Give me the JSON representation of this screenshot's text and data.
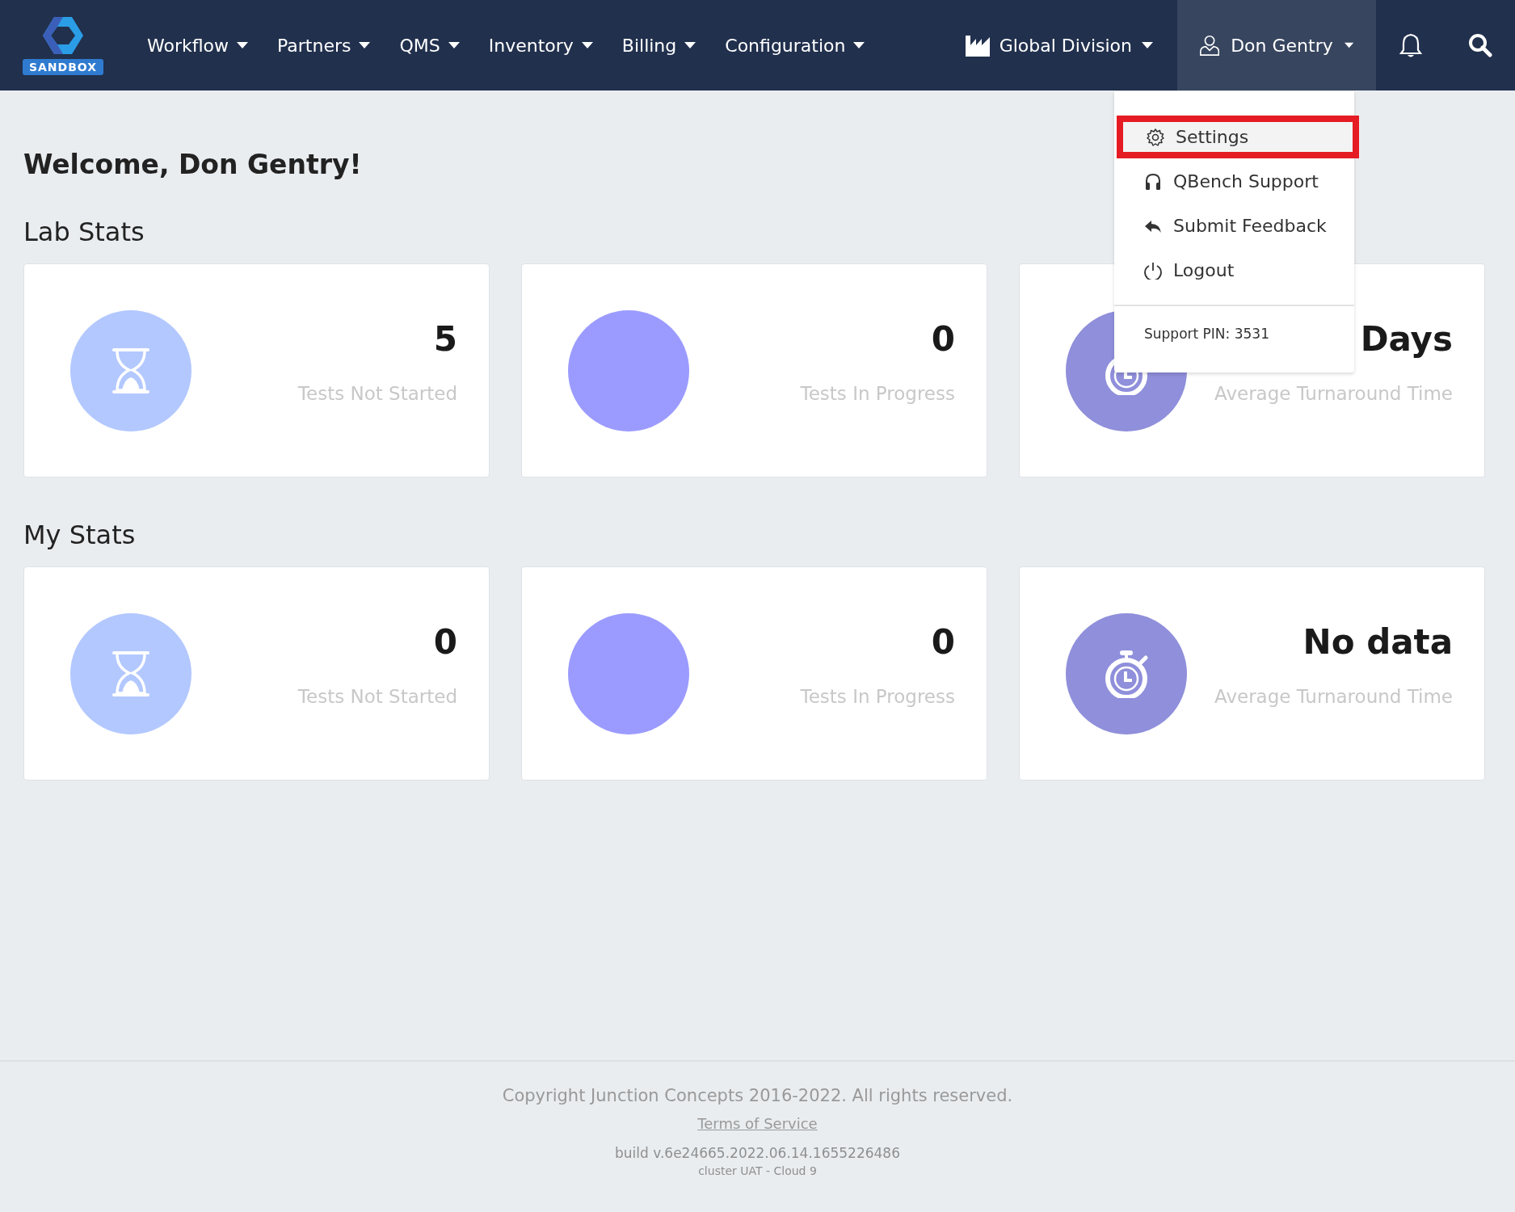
{
  "nav": {
    "logo_badge": "SANDBOX",
    "menus": [
      {
        "label": "Workflow"
      },
      {
        "label": "Partners"
      },
      {
        "label": "QMS"
      },
      {
        "label": "Inventory"
      },
      {
        "label": "Billing"
      },
      {
        "label": "Configuration"
      }
    ],
    "division": {
      "label": "Global Division"
    },
    "user": {
      "label": "Don Gentry",
      "expanded": true
    }
  },
  "user_menu": {
    "items": [
      {
        "kind": "settings",
        "label": "Settings",
        "highlighted": true
      },
      {
        "kind": "support",
        "label": "QBench Support",
        "highlighted": false
      },
      {
        "kind": "feedback",
        "label": "Submit Feedback",
        "highlighted": false
      },
      {
        "kind": "logout",
        "label": "Logout",
        "highlighted": false
      }
    ],
    "support_pin": "Support PIN: 3531"
  },
  "welcome": "Welcome, Don Gentry!",
  "sections": [
    {
      "title": "Lab Stats",
      "cards": [
        {
          "kind": "hourglass",
          "color": "#b3c8ff",
          "value": "5",
          "label": "Tests Not Started"
        },
        {
          "kind": "plain",
          "color": "#9b9bff",
          "value": "0",
          "label": "Tests In Progress"
        },
        {
          "kind": "stopwatch",
          "color": "#8f8fdb",
          "value": "Days",
          "label": "Average Turnaround Time"
        }
      ]
    },
    {
      "title": "My Stats",
      "cards": [
        {
          "kind": "hourglass",
          "color": "#b3c8ff",
          "value": "0",
          "label": "Tests Not Started"
        },
        {
          "kind": "plain",
          "color": "#9b9bff",
          "value": "0",
          "label": "Tests In Progress"
        },
        {
          "kind": "stopwatch",
          "color": "#8f8fdb",
          "value": "No data",
          "label": "Average Turnaround Time"
        }
      ]
    }
  ],
  "footer": {
    "copyright": "Copyright Junction Concepts 2016-2022. All rights reserved.",
    "terms_link": "Terms of Service",
    "build": "build v.6e24665.2022.06.14.1655226486",
    "cluster": "cluster UAT - Cloud 9"
  }
}
